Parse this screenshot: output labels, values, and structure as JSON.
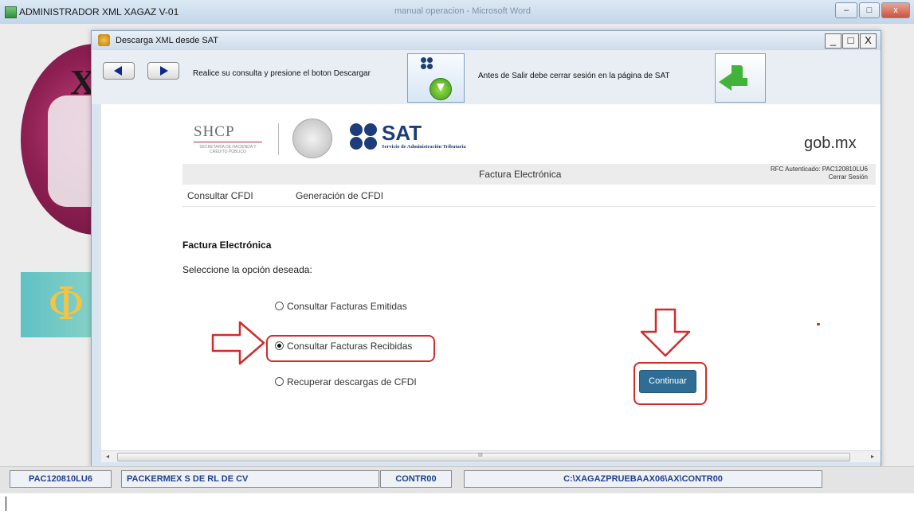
{
  "app": {
    "title": "ADMINISTRADOR XML XAGAZ V-01",
    "background_window_title": "manual operacion - Microsoft Word"
  },
  "dialog": {
    "title": "Descarga XML desde SAT",
    "controls": {
      "minimize": "_",
      "maximize": "□",
      "close": "X"
    }
  },
  "toolbar": {
    "instruction": "Realice su consulta y presione el boton Descargar",
    "logout_note": "Antes de Salir debe cerrar sesión en la página de SAT",
    "download_icon": "sat-download-icon",
    "exit_icon": "green-return-arrow-icon"
  },
  "web": {
    "shcp_logo": "SHCP",
    "shcp_subtitle": "SECRETARÍA DE HACIENDA Y CRÉDITO PÚBLICO",
    "sat_logo": "SAT",
    "sat_subtitle": "Servicio de Administración Tributaria",
    "gob_logo": "gob.mx",
    "nav_title": "Factura Electrónica",
    "rfc_authenticated": "RFC Autenticado: PAC120810LU6",
    "logout_link": "Cerrar Sesión",
    "menu": {
      "consultar": "Consultar CFDI",
      "generacion": "Generación de CFDI"
    },
    "section_title": "Factura Electrónica",
    "instruction": "Seleccione la opción deseada:",
    "options": [
      {
        "label": "Consultar Facturas Emitidas",
        "selected": false
      },
      {
        "label": "Consultar Facturas Recibidas",
        "selected": true
      },
      {
        "label": "Recuperar descargas de CFDI",
        "selected": false
      }
    ],
    "continue_button": "Continuar"
  },
  "status_bar": {
    "rfc": "PAC120810LU6",
    "company": "PACKERMEX S DE RL DE CV",
    "code": "CONTR00",
    "path": "C:\\XAGAZPRUEBAAX06\\AX\\CONTR00"
  },
  "scrollbar": {
    "thumb_glyph": "III"
  },
  "colors": {
    "annotation_red": "#d12c2c",
    "continue_button": "#2f6d95",
    "sat_blue": "#1c3d7a",
    "status_text": "#1f3f8f"
  }
}
